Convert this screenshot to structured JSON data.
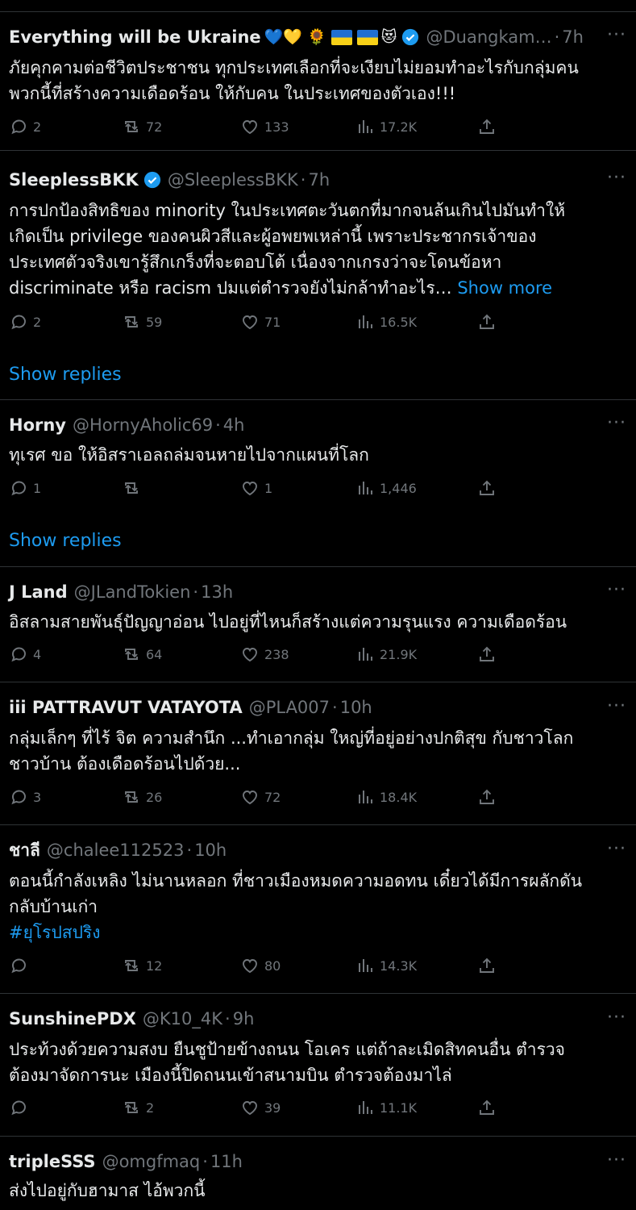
{
  "tweets": [
    {
      "name": "Everything will be Ukraine",
      "name_emoji": "💙💛 🌻",
      "name_emoji_tail": "😻",
      "handle": "@Duangkam…",
      "dot": "·",
      "time": "7h",
      "lines": [
        "ภัยคุกคามต่อชีวิตประชาชน ทุกประเทศเลือกที่จะเงียบไม่ยอมทำอะไรกับกลุ่มคน",
        "พวกนี้ที่สร้างความเดือดร้อน ให้กับคน ในประเทศของตัวเอง!!!"
      ],
      "replies": "2",
      "retweets": "72",
      "likes": "133",
      "views": "17.2K"
    },
    {
      "name": "SleeplessBKK",
      "handle": "@SleeplessBKK",
      "dot": "·",
      "time": "7h",
      "lines": [
        "การปกป้องสิทธิของ minority ในประเทศตะวันตกที่มากจนล้นเกินไปมันทำให้",
        "เกิดเป็น privilege ของคนผิวสีและผู้อพยพเหล่านี้ เพราะประชากรเจ้าของ",
        "ประเทศตัวจริงเขารู้สึกเกร็งที่จะตอบโต้ เนื่องจากเกรงว่าจะโดนข้อหา",
        "discriminate หรือ racism ปมแต่ตำรวจยังไม่กล้าทำอะไร…"
      ],
      "show_more": "Show more",
      "replies": "2",
      "retweets": "59",
      "likes": "71",
      "views": "16.5K",
      "show_replies": "Show replies"
    },
    {
      "name": "Horny",
      "handle": "@HornyAholic69",
      "dot": "·",
      "time": "4h",
      "lines": [
        "ทุเรศ ขอ ให้อิสราเอลถล่มจนหายไปจากแผนที่โลก"
      ],
      "replies": "1",
      "retweets": "",
      "likes": "1",
      "views": "1,446",
      "show_replies": "Show replies"
    },
    {
      "name": "J Land",
      "handle": "@JLandTokien",
      "dot": "·",
      "time": "13h",
      "lines": [
        "อิสลามสายพันธุ์ปัญญาอ่อน ไปอยู่ที่ไหนก็สร้างแต่ความรุนแรง ความเดือดร้อน"
      ],
      "replies": "4",
      "retweets": "64",
      "likes": "238",
      "views": "21.9K"
    },
    {
      "name": "iii PATTRAVUT VATAYOTA",
      "handle": "@PLA007",
      "dot": "·",
      "time": "10h",
      "lines": [
        "กลุ่มเล็กๆ ที่ไร้ จิต ความสำนึก ...ทำเอากลุ่ม ใหญ่ที่อยู่อย่างปกติสุข กับชาวโลก",
        "ชาวบ้าน ต้องเดือดร้อนไปด้วย..."
      ],
      "replies": "3",
      "retweets": "26",
      "likes": "72",
      "views": "18.4K"
    },
    {
      "name": "ชาลี",
      "handle": "@chalee112523",
      "dot": "·",
      "time": "10h",
      "lines": [
        "ตอนนี้กำลังเหลิง  ไม่นานหลอก ที่ชาวเมืองหมดความอดทน เดี๋ยวได้มีการผลักดัน",
        "กลับบ้านเก่า"
      ],
      "hashtag": "#ยุโรปสปริง",
      "replies": "",
      "retweets": "12",
      "likes": "80",
      "views": "14.3K"
    },
    {
      "name": "SunshinePDX",
      "handle": "@K10_4K",
      "dot": "·",
      "time": "9h",
      "lines": [
        "ประท้วงด้วยความสงบ ยืนชูป้ายข้างถนน โอเคร  แต่ถ้าละเมิดสิทคนอื่น ตำรวจ",
        "ต้องมาจัดการนะ เมืองนี้ปิดถนนเข้าสนามบิน ตำรวจต้องมาไล่"
      ],
      "replies": "",
      "retweets": "2",
      "likes": "39",
      "views": "11.1K"
    },
    {
      "name": "tripleSSS",
      "handle": "@omgfmaq",
      "dot": "·",
      "time": "11h",
      "lines": [
        "ส่งไปอยู่กับฮามาส ไอ้พวกนี้"
      ]
    }
  ],
  "icons": {
    "reply": "reply-icon",
    "retweet": "retweet-icon",
    "like": "heart-icon",
    "views": "views-icon",
    "share": "share-icon",
    "more": "more-icon",
    "verified": "verified-badge-icon"
  },
  "colors": {
    "background": "#000000",
    "text": "#e7e9ea",
    "muted": "#71767b",
    "link": "#1d9bf0",
    "divider": "#2f3336"
  }
}
